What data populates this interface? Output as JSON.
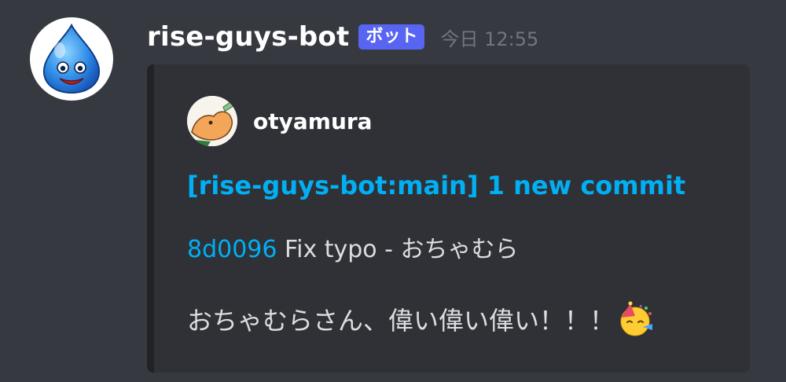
{
  "message": {
    "username": "rise-guys-bot",
    "bot_badge": "ボット",
    "timestamp": "今日 12:55",
    "avatar_icon": "slime-avatar-icon"
  },
  "embed": {
    "author_name": "otyamura",
    "author_avatar_icon": "user-avatar-icon",
    "title": "[rise-guys-bot:main] 1 new commit",
    "commit": {
      "hash": "8d0096",
      "message": "Fix typo - おちゃむら"
    },
    "text": "おちゃむらさん、偉い偉い偉い！！！",
    "emoji": "partying-face-icon",
    "colors": {
      "link": "#00aff4",
      "bot_badge": "#5865f2",
      "embed_bg": "#2f3136",
      "chat_bg": "#36393f"
    }
  }
}
